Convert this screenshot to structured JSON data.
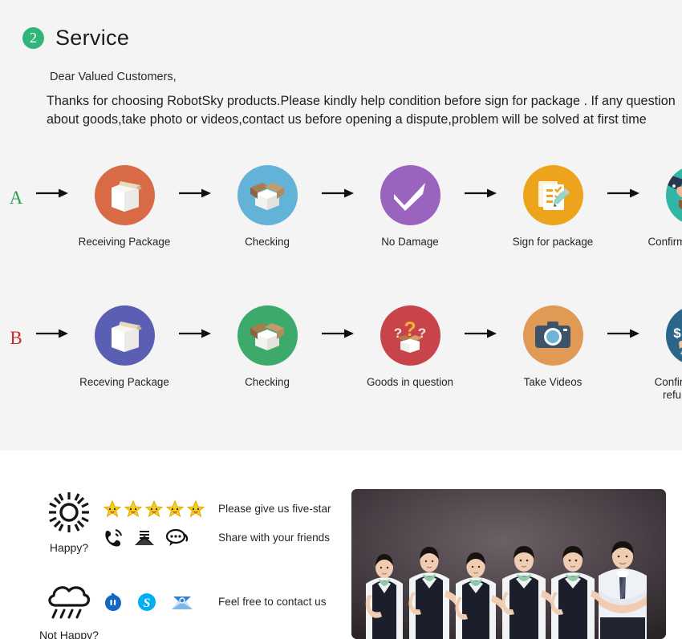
{
  "service": {
    "badge_number": "2",
    "title": "Service",
    "greeting": "Dear Valued Customers,",
    "paragraph": "Thanks for choosing RobotSky products.Please kindly help condition before sign for package . If any question about goods,take photo or videos,contact us before opening a dispute,problem will be solved at first time",
    "accent_color": "#32b57a"
  },
  "flow_rows": [
    {
      "letter": "A",
      "letter_color": "#2e9e4e",
      "steps": [
        {
          "label": "Receiving Package",
          "icon": "closed-box-icon",
          "circle_color": "#d96a46"
        },
        {
          "label": "Checking",
          "icon": "open-box-icon",
          "circle_color": "#63b3d8"
        },
        {
          "label": "No Damage",
          "icon": "checkmark-icon",
          "circle_color": "#9a63bd"
        },
        {
          "label": "Sign for package",
          "icon": "sign-document-icon",
          "circle_color": "#eda31b"
        },
        {
          "label": "Confirm the delivery",
          "icon": "handshake-icon",
          "circle_color": "#31b5a5"
        }
      ]
    },
    {
      "letter": "B",
      "letter_color": "#c92a2a",
      "steps": [
        {
          "label": "Receving Package",
          "icon": "closed-box-icon",
          "circle_color": "#5a5fb4"
        },
        {
          "label": "Checking",
          "icon": "open-box-icon",
          "circle_color": "#3da96a"
        },
        {
          "label": "Goods in question",
          "icon": "question-box-icon",
          "circle_color": "#c9434a"
        },
        {
          "label": "Take Videos",
          "icon": "camera-icon",
          "circle_color": "#e09a55"
        },
        {
          "label": "Confirm problem,\nrefund money",
          "icon": "support-agent-icon",
          "circle_color": "#2b6589"
        }
      ]
    }
  ],
  "contact": {
    "moods": [
      {
        "icon": "sun-icon",
        "label": "Happy?"
      },
      {
        "icon": "rain-cloud-icon",
        "label": "Not Happy?"
      }
    ],
    "rows": [
      {
        "icons": [
          "star-icon",
          "star-icon",
          "star-icon",
          "star-icon",
          "star-icon"
        ],
        "message": "Please give us five-star"
      },
      {
        "icons": [
          "phone-ring-icon",
          "mail-icon",
          "chat-bubble-icon"
        ],
        "message": "Share with your friends"
      },
      {
        "icons": [
          "messenger-icon",
          "skype-icon",
          "email-envelope-icon"
        ],
        "message": "Feel free to contact us"
      }
    ],
    "photo_alt": "team-photo"
  }
}
